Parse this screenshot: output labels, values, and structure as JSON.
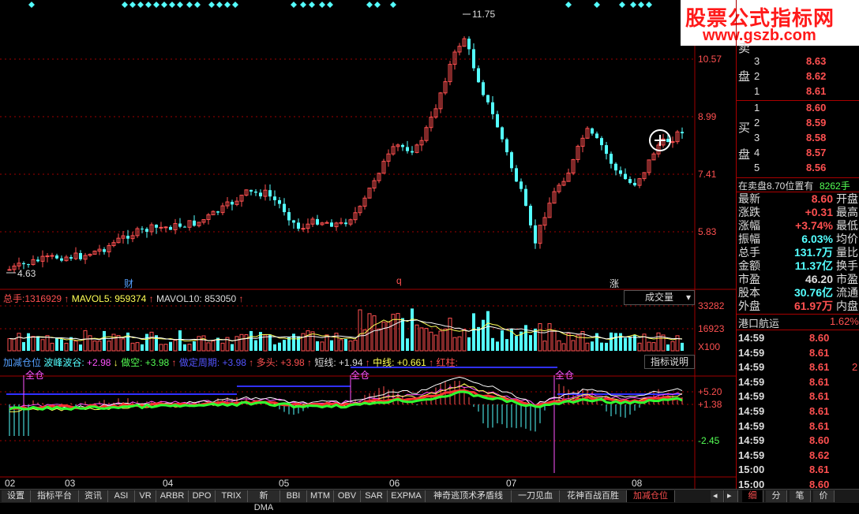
{
  "watermark": {
    "line1": "股票公式指标网",
    "line2": "www.gszb.com"
  },
  "price_axis": {
    "labels": [
      "10.57",
      "8.99",
      "7.41",
      "5.83"
    ]
  },
  "price_marks": {
    "high": "11.75",
    "low": "4.63"
  },
  "event_marks": {
    "m1": "财",
    "m2": "q",
    "m3": "涨"
  },
  "volume_header": {
    "total_label": "总手:",
    "total_value": "1316929",
    "mavol5_label": "MAVOL5:",
    "mavol5_value": "959374",
    "mavol10_label": "MAVOL10:",
    "mavol10_value": "853050",
    "dropdown": "成交量"
  },
  "volume_axis": {
    "labels": [
      "33282",
      "16923"
    ],
    "unit": "X100"
  },
  "indicator_header": {
    "name": "加减仓位",
    "bolangu_label": "波峰波谷:",
    "bolangu_value": "+2.98",
    "zuokong_label": "做空:",
    "zuokong_value": "+3.98",
    "zdzq_label": "做定周期:",
    "zdzq_value": "+3.98",
    "duotou_label": "多头:",
    "duotou_value": "+3.98",
    "duanxian_label": "短线:",
    "duanxian_value": "+1.94",
    "zhongxian_label": "中线:",
    "zhongxian_value": "+0.661",
    "hongzhu_label": "红柱:",
    "help_button": "指标说明"
  },
  "indicator_axis": {
    "labels": [
      "+5.20",
      "+1.38",
      "-2.45"
    ]
  },
  "quanchang_marks": [
    "全仓",
    "全仓",
    "全仓"
  ],
  "date_axis": [
    "02",
    "03",
    "04",
    "05",
    "06",
    "07",
    "08"
  ],
  "sidepanel": {
    "sell_label1": "卖",
    "sell_label2": "盘",
    "buy_label1": "买",
    "buy_label2": "盘",
    "sell_rows": [
      {
        "n": "3",
        "p": "8.63"
      },
      {
        "n": "2",
        "p": "8.62"
      },
      {
        "n": "1",
        "p": "8.61"
      }
    ],
    "buy_rows": [
      {
        "n": "1",
        "p": "8.60"
      },
      {
        "n": "2",
        "p": "8.59"
      },
      {
        "n": "3",
        "p": "8.58"
      },
      {
        "n": "4",
        "p": "8.57"
      },
      {
        "n": "5",
        "p": "8.56"
      }
    ],
    "order_text": "在卖盘8.70位置有",
    "order_value": "8262手",
    "stats": [
      {
        "l": "最新",
        "v": "8.60",
        "r": "开盘",
        "c": "red"
      },
      {
        "l": "涨跌",
        "v": "+0.31",
        "r": "最高",
        "c": "red"
      },
      {
        "l": "涨幅",
        "v": "+3.74%",
        "r": "最低",
        "c": "red"
      },
      {
        "l": "振幅",
        "v": "6.03%",
        "r": "均价",
        "c": "cyan"
      },
      {
        "l": "总手",
        "v": "131.7万",
        "r": "量比",
        "c": "cyan"
      },
      {
        "l": "金额",
        "v": "11.37亿",
        "r": "换手",
        "c": "cyan"
      },
      {
        "l": "市盈",
        "v": "46.20",
        "r": "市盈",
        "c": "white"
      },
      {
        "l": "股本",
        "v": "30.76亿",
        "r": "流通",
        "c": "cyan"
      },
      {
        "l": "外盘",
        "v": "61.97万",
        "r": "内盘",
        "c": "red"
      }
    ],
    "company": "港口航运",
    "company_change": "1.62%",
    "ticks": [
      {
        "t": "14:59",
        "p": "8.60"
      },
      {
        "t": "14:59",
        "p": "8.61"
      },
      {
        "t": "14:59",
        "p": "8.61"
      },
      {
        "t": "14:59",
        "p": "8.61"
      },
      {
        "t": "14:59",
        "p": "8.61"
      },
      {
        "t": "14:59",
        "p": "8.61"
      },
      {
        "t": "14:59",
        "p": "8.61"
      },
      {
        "t": "14:59",
        "p": "8.60"
      },
      {
        "t": "14:59",
        "p": "8.62"
      },
      {
        "t": "15:00",
        "p": "8.61"
      },
      {
        "t": "15:00",
        "p": "8.60"
      }
    ],
    "tick_extra": "2"
  },
  "bottom_tabs": [
    "设置",
    "指标平台",
    "资讯",
    "ASI",
    "VR",
    "ARBR",
    "DPO",
    "TRIX",
    "新DMA",
    "BBI",
    "MTM",
    "OBV",
    "SAR",
    "EXPMA",
    "神奇逃顶术矛盾线",
    "一刀见血",
    "花神百战百胜",
    "加减仓位"
  ],
  "bottom_right_tabs": [
    "细",
    "分",
    "笔",
    "价"
  ],
  "colors": {
    "up": "#ff5050",
    "down": "#54ffff",
    "grid": "#a00000",
    "ma_white": "#ffffff",
    "ma_yellow": "#ffff54",
    "ma_magenta": "#ff54ff"
  }
}
